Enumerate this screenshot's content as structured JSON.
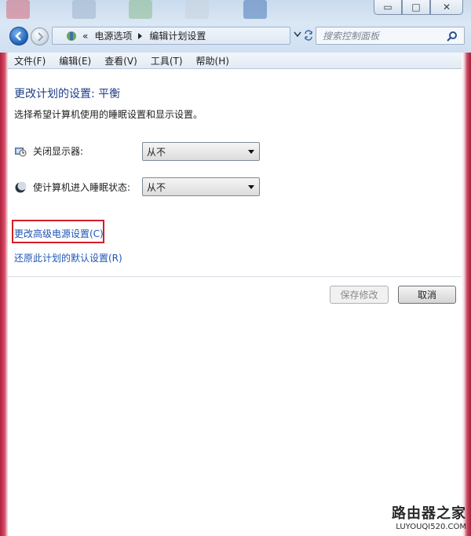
{
  "window": {
    "minimize_glyph": "▭",
    "maximize_glyph": "□",
    "close_glyph": "✕"
  },
  "address_bar": {
    "overflow": "«",
    "crumbs": [
      "电源选项",
      "编辑计划设置"
    ]
  },
  "search": {
    "placeholder": "搜索控制面板"
  },
  "menu": [
    "文件(F)",
    "编辑(E)",
    "查看(V)",
    "工具(T)",
    "帮助(H)"
  ],
  "page": {
    "title": "更改计划的设置: 平衡",
    "subtitle": "选择希望计算机使用的睡眠设置和显示设置。",
    "settings": [
      {
        "label": "关闭显示器:",
        "value": "从不",
        "icon": "monitor-icon"
      },
      {
        "label": "使计算机进入睡眠状态:",
        "value": "从不",
        "icon": "sleep-moon-icon"
      }
    ],
    "links": {
      "advanced": "更改高级电源设置(C)",
      "restore": "还原此计划的默认设置(R)"
    },
    "buttons": {
      "save": "保存修改",
      "cancel": "取消"
    }
  },
  "watermark": {
    "cn": "路由器之家",
    "en": "LUYOUQI520.COM"
  },
  "colors": {
    "title": "#1e3d8a",
    "link": "#1e56b4",
    "highlight": "#d41e2a"
  }
}
